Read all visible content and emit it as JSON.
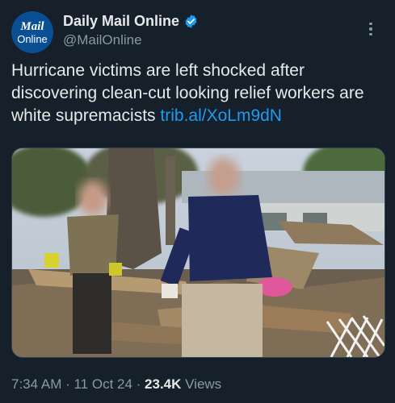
{
  "account": {
    "avatar_line1": "Mail",
    "avatar_line2": "Online",
    "display_name": "Daily Mail Online",
    "handle": "@MailOnline",
    "verified_color": "#1d9bf0"
  },
  "tweet": {
    "text": "Hurricane victims are left shocked after discovering clean-cut looking relief workers are white supremacists ",
    "link": "trib.al/XoLm9dN"
  },
  "meta": {
    "time": "7:34 AM",
    "sep1": " · ",
    "date": "11 Oct 24",
    "sep2": " · ",
    "views_count": "23.4K",
    "views_label": " Views"
  },
  "icons": [
    "verified-badge-icon",
    "more-options-icon"
  ]
}
